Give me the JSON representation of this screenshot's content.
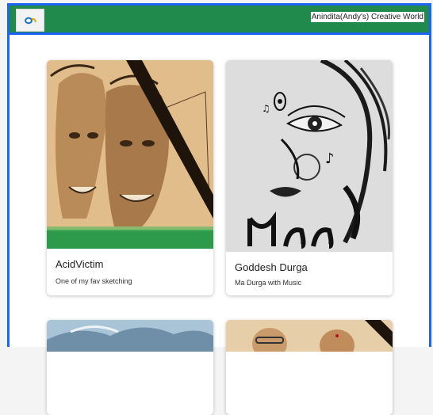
{
  "navbar": {
    "logo_icon": "spiral-logo-icon",
    "brand": "Anindita(Andy's) Creative World"
  },
  "cards": [
    {
      "title": "AcidVictim",
      "description": "One of my fav sketching",
      "image_icon": "two-faces-sketch-image"
    },
    {
      "title": "Goddesh Durga",
      "description": "Ma Durga with Music",
      "image_icon": "durga-sketch-image"
    },
    {
      "title": "",
      "description": "",
      "image_icon": "mountain-painting-image"
    },
    {
      "title": "",
      "description": "",
      "image_icon": "portrait-sketch-image"
    }
  ],
  "colors": {
    "navbar": "#1f8a4c",
    "frame_border": "#1c64f2",
    "card_bg": "#ffffff"
  }
}
